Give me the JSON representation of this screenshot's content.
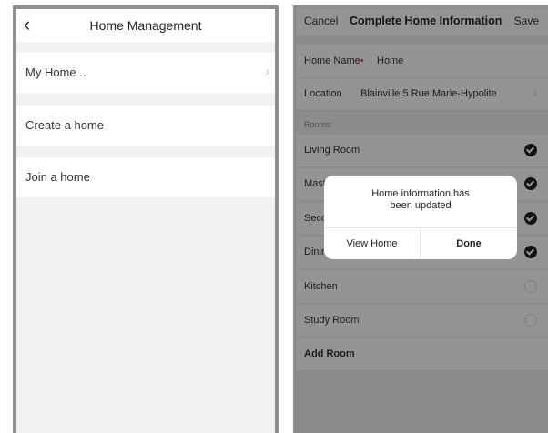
{
  "left": {
    "back_icon": "chevron-left-icon",
    "title": "Home Management",
    "items": [
      {
        "label": "My Home ..",
        "chevron": "›"
      },
      {
        "label": "Create a home"
      },
      {
        "label": "Join a home"
      }
    ]
  },
  "right": {
    "header": {
      "cancel": "Cancel",
      "title": "Complete Home Information",
      "save": "Save"
    },
    "home_name_label": "Home Name",
    "required_mark": "•",
    "home_name_value": "Home",
    "location_label": "Location",
    "location_value": "Blainville 5 Rue Marie-Hypolite",
    "location_chevron": "›",
    "rooms_label": "Rooms:",
    "rooms": [
      {
        "name": "Living Room",
        "checked": true
      },
      {
        "name": "Mast",
        "checked": true
      },
      {
        "name": "Seco",
        "checked": true
      },
      {
        "name": "Dinin",
        "checked": true
      },
      {
        "name": "Kitchen",
        "checked": false
      },
      {
        "name": "Study Room",
        "checked": false
      }
    ],
    "add_room": "Add Room"
  },
  "dialog": {
    "message_line1": "Home information has",
    "message_line2": "been updated",
    "view_home": "View Home",
    "done": "Done"
  },
  "colors": {
    "frame": "#8d8d8d",
    "required": "#e3483f",
    "check_on": "#1f1f1f"
  }
}
